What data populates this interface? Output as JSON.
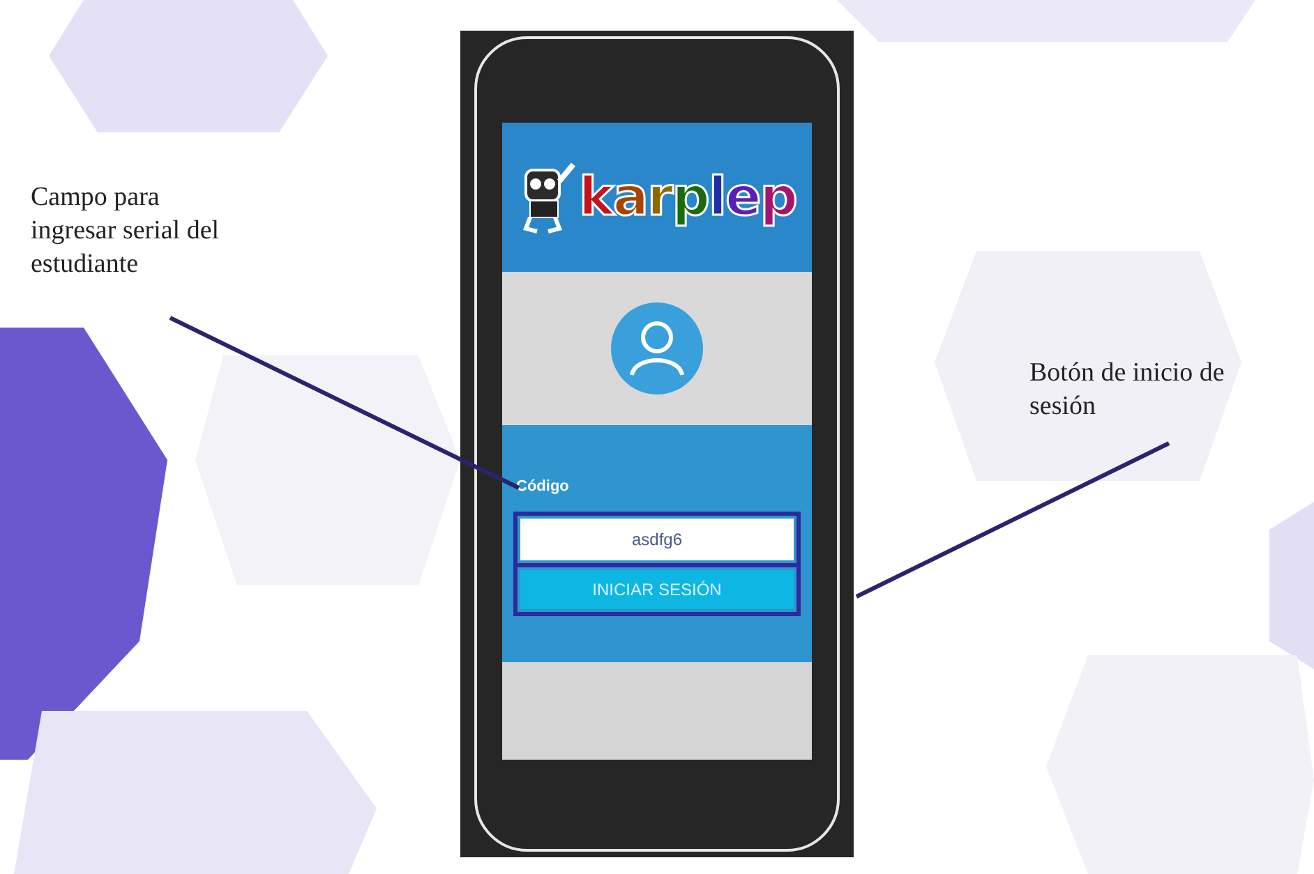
{
  "annotations": [
    {
      "text": "Campo para ingresar serial del estudiante"
    },
    {
      "text": "Botón de inicio de sesión"
    }
  ],
  "app": {
    "logo": "karplep",
    "code_label": "Código",
    "code_field": {
      "value": "asdfg6"
    },
    "login_button": "INICIAR SESIÓN"
  }
}
